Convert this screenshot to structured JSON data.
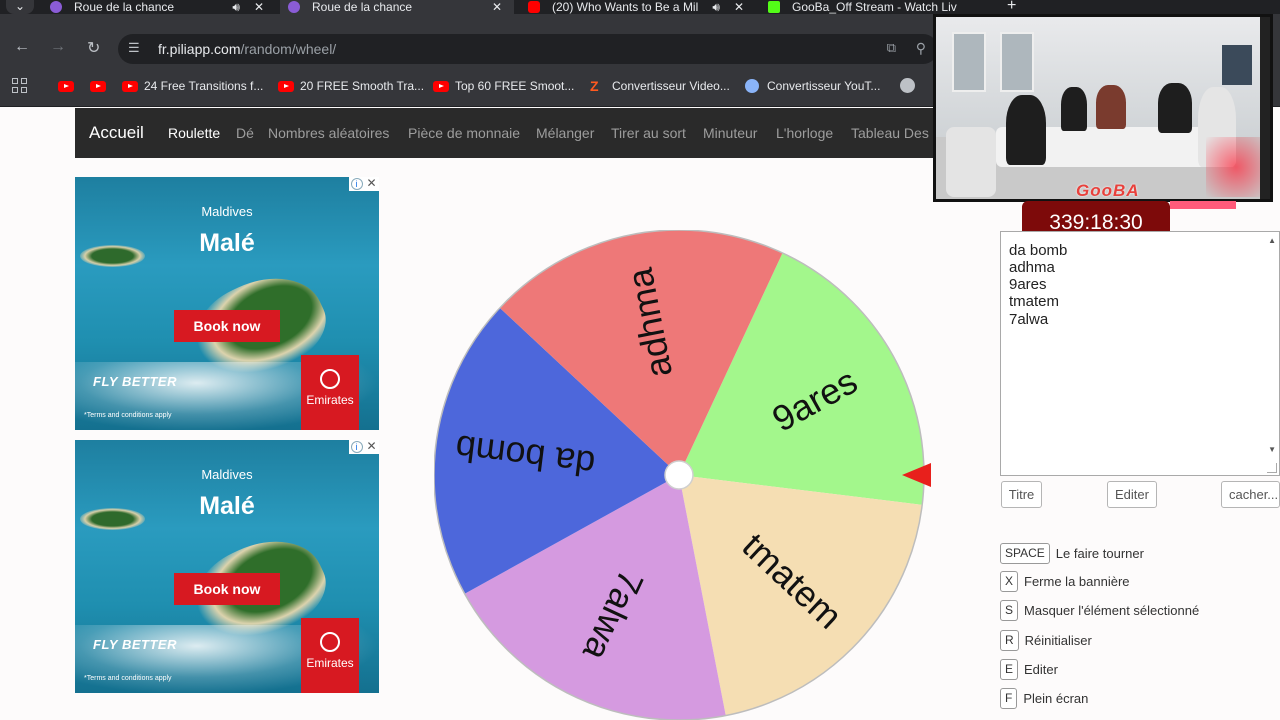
{
  "browser": {
    "tabs": [
      {
        "title": "Roue de la chance",
        "active": false,
        "audio": true,
        "fav": "#8a5cd6"
      },
      {
        "title": "Roue de la chance",
        "active": true,
        "audio": false,
        "fav": "#8a5cd6"
      },
      {
        "title": "(20) Who Wants to Be a Mil",
        "active": false,
        "audio": true,
        "fav": "#ff0000"
      },
      {
        "title": "GooBa_Off Stream - Watch Liv",
        "active": false,
        "audio": true,
        "fav": "#53fc18"
      }
    ],
    "url_host": "fr.piliapp.com",
    "url_path": "/random/wheel/",
    "bookmarks": [
      {
        "label": "",
        "icon": "youtube-icon"
      },
      {
        "label": "",
        "icon": "youtube-icon"
      },
      {
        "label": "24 Free Transitions f...",
        "icon": "youtube-icon"
      },
      {
        "label": "20 FREE Smooth Tra...",
        "icon": "youtube-icon"
      },
      {
        "label": "Top 60 FREE Smoot...",
        "icon": "youtube-icon"
      },
      {
        "label": "Convertisseur Video...",
        "icon": "z-icon"
      },
      {
        "label": "Convertisseur YouT...",
        "icon": "swirl-icon"
      }
    ]
  },
  "site": {
    "brand": "Accueil",
    "nav": [
      {
        "label": "Roulette",
        "active": true
      },
      {
        "label": "Dé",
        "active": false
      },
      {
        "label": "Nombres aléatoires",
        "active": false
      },
      {
        "label": "Pièce de monnaie",
        "active": false
      },
      {
        "label": "Mélanger",
        "active": false
      },
      {
        "label": "Tirer au sort",
        "active": false
      },
      {
        "label": "Minuteur",
        "active": false
      },
      {
        "label": "L'horloge",
        "active": false
      },
      {
        "label": "Tableau Des",
        "active": false
      }
    ]
  },
  "ads": [
    {
      "place_small": "Maldives",
      "place_big": "Malé",
      "cta": "Book now",
      "slogan": "FLY BETTER",
      "terms": "*Terms and conditions apply",
      "brand": "Emirates"
    },
    {
      "place_small": "Maldives",
      "place_big": "Malé",
      "cta": "Book now",
      "slogan": "FLY BETTER",
      "terms": "*Terms and conditions apply",
      "brand": "Emirates"
    }
  ],
  "wheel": {
    "segments": [
      {
        "label": "9ares",
        "color": "#a3f78c"
      },
      {
        "label": "tmatem",
        "color": "#f5deb3"
      },
      {
        "label": "7alwa",
        "color": "#d59ae0"
      },
      {
        "label": "da bomb",
        "color": "#4d67db"
      },
      {
        "label": "adhma",
        "color": "#ee7878"
      }
    ],
    "pointer_color": "#e8201c"
  },
  "stream": {
    "timer": "339:18:30",
    "logo": "GooBA"
  },
  "entries": {
    "lines": [
      "da bomb",
      "adhma",
      "9ares",
      "tmatem",
      "7alwa"
    ]
  },
  "buttons": {
    "title": "Titre",
    "edit": "Editer",
    "hide": "cacher..."
  },
  "shortcuts": [
    {
      "key": "SPACE",
      "label": "Le faire tourner"
    },
    {
      "key": "X",
      "label": "Ferme la bannière"
    },
    {
      "key": "S",
      "label": "Masquer l'élément sélectionné"
    },
    {
      "key": "R",
      "label": "Réinitialiser"
    },
    {
      "key": "E",
      "label": "Editer"
    },
    {
      "key": "F",
      "label": "Plein écran"
    }
  ]
}
